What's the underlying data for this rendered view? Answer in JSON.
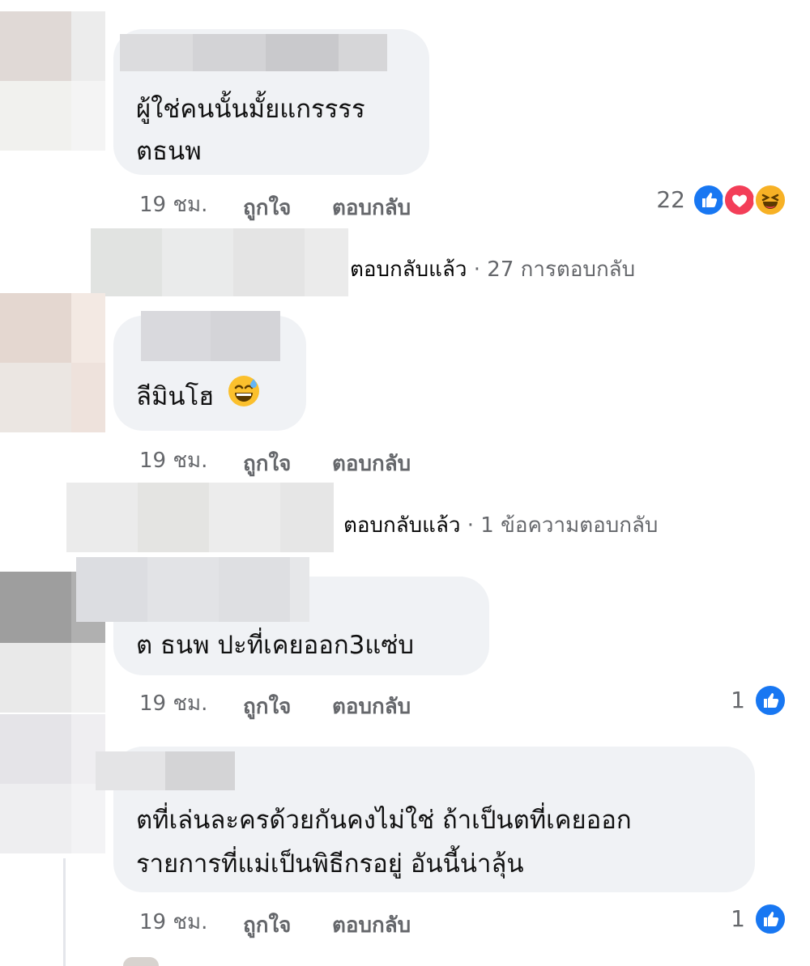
{
  "colors": {
    "bubble": "#f0f2f5",
    "like": "#1877f2",
    "love": "#f33e58",
    "haha": "#f7b125",
    "meta": "#65676b"
  },
  "comments": [
    {
      "text_lines": [
        "ผู้ใช่คนนั้นมั้ยแกรรรร",
        "ตธนพ"
      ],
      "time": "19 ชม.",
      "like_label": "ถูกใจ",
      "reply_label": "ตอบกลับ",
      "reaction_count": "22",
      "reaction_icons": [
        "like-icon",
        "love-icon",
        "haha-icon"
      ],
      "replies_label": "ตอบกลับแล้ว",
      "replies_count": "27 การตอบกลับ"
    },
    {
      "text_lines": [
        "ลีมินโฮ"
      ],
      "emoji": "sweat-smile-emoji",
      "time": "19 ชม.",
      "like_label": "ถูกใจ",
      "reply_label": "ตอบกลับ",
      "replies_label": "ตอบกลับแล้ว",
      "replies_count": "1 ข้อความตอบกลับ"
    },
    {
      "text_lines": [
        "ต ธนพ ปะที่เคยออก3แซ่บ"
      ],
      "time": "19 ชม.",
      "like_label": "ถูกใจ",
      "reply_label": "ตอบกลับ",
      "reaction_count": "1",
      "reaction_icons": [
        "like-icon"
      ]
    },
    {
      "text_lines": [
        "ตที่เล่นละครด้วยกันคงไม่ใช่  ถ้าเป็นตที่เคยออก",
        "รายการที่แม่เป็นพิธีกรอยู่ อันนี้น่าลุ้น"
      ],
      "time": "19 ชม.",
      "like_label": "ถูกใจ",
      "reply_label": "ตอบกลับ",
      "reaction_count": "1",
      "reaction_icons": [
        "like-icon"
      ]
    }
  ]
}
